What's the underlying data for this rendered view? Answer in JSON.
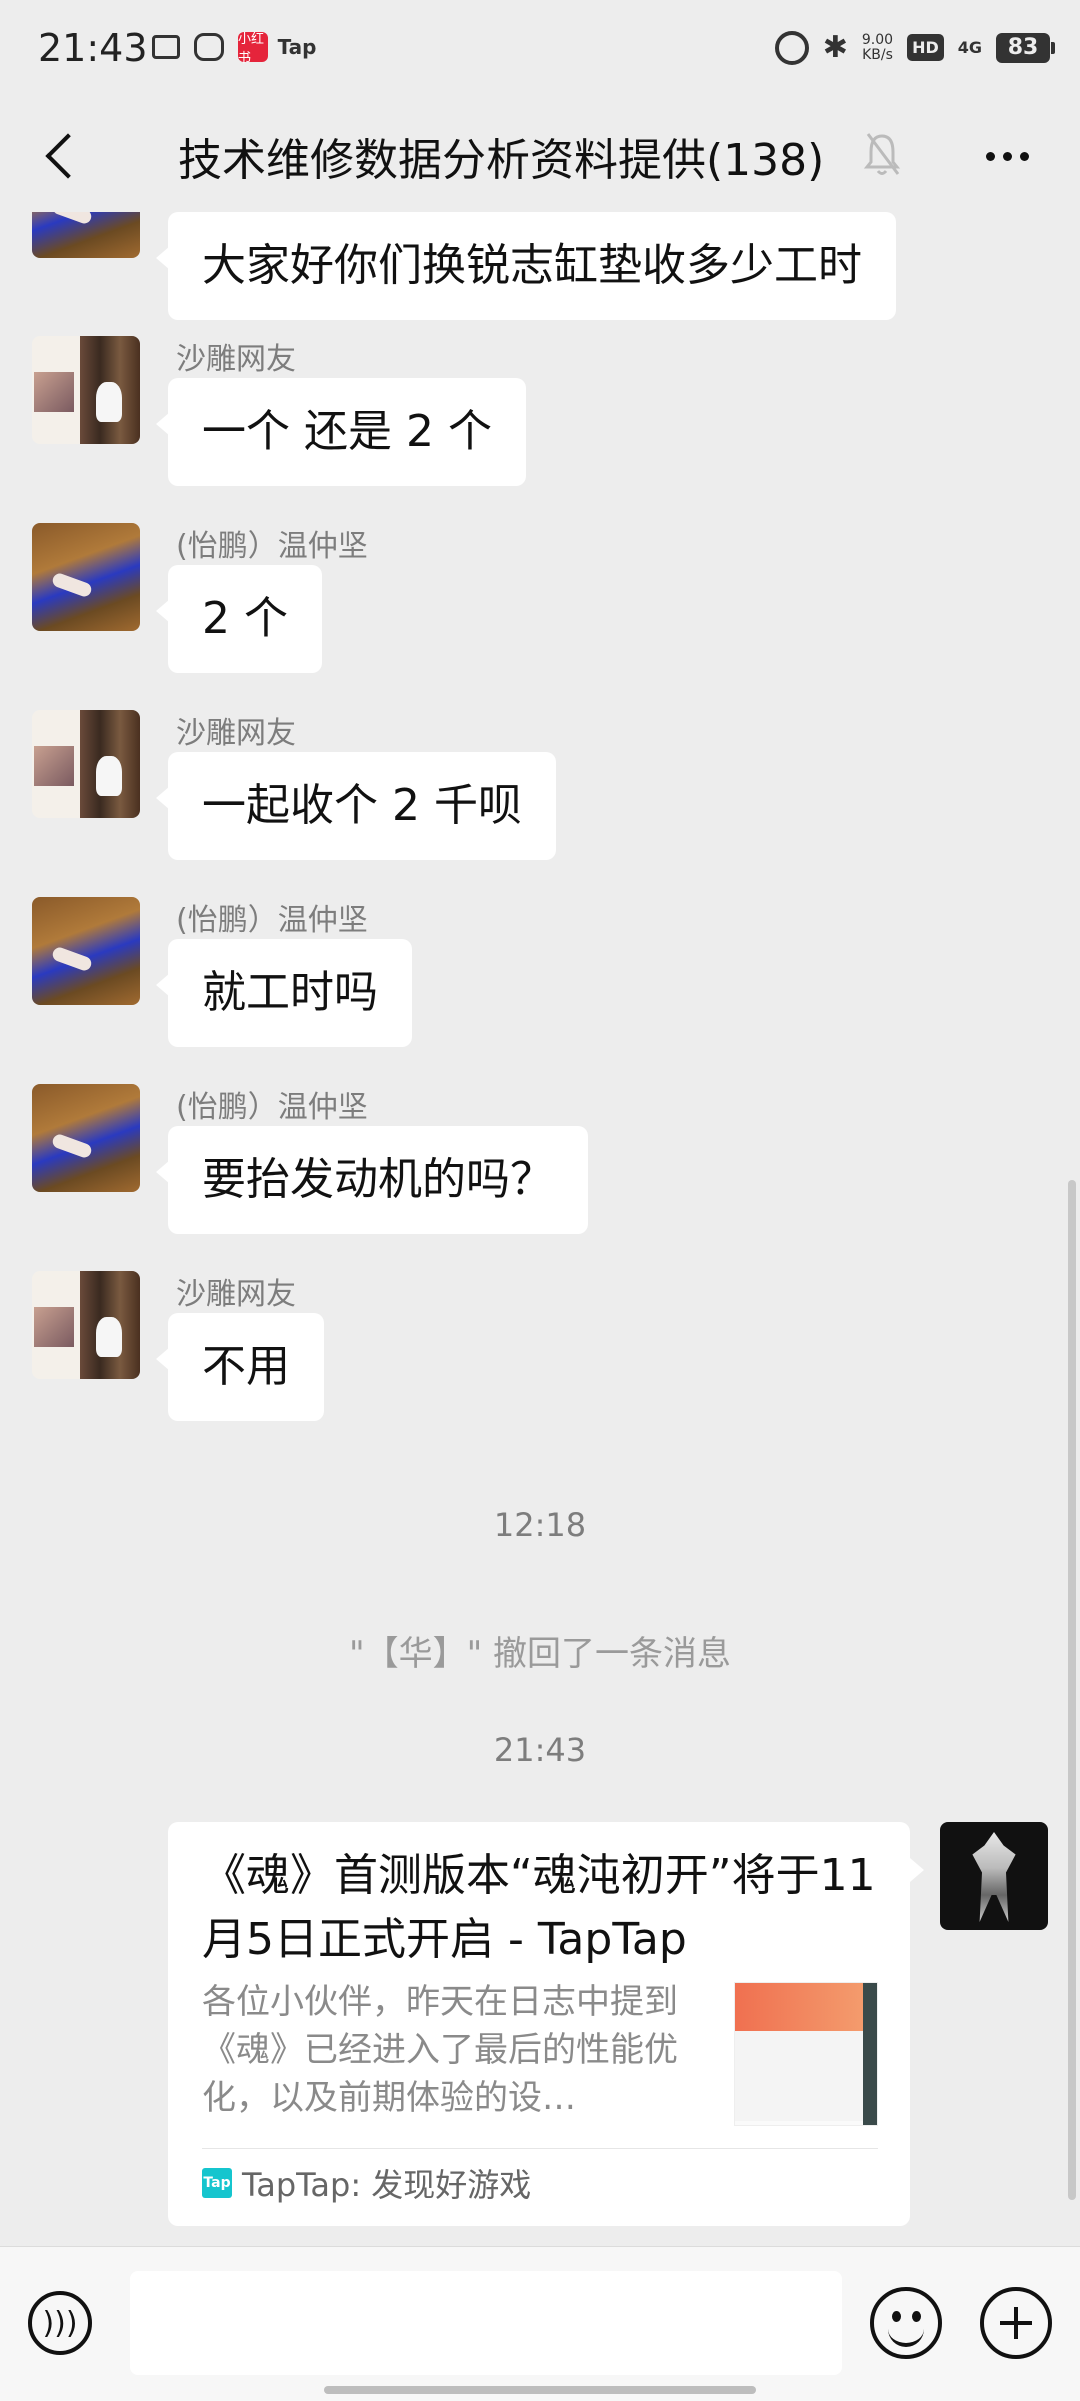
{
  "status_bar": {
    "time": "21:43",
    "app_badge_text": "Tap",
    "red_app_text": "小红书",
    "net_speed_value": "9.00",
    "net_speed_unit": "KB/s",
    "hd_label": "HD",
    "signal_label": "4G",
    "battery": "83"
  },
  "header": {
    "title": "技术维修数据分析资料提供(138)"
  },
  "messages": [
    {
      "sender": "",
      "text": "大家好你们换锐志缸垫收多少工时"
    },
    {
      "sender": "沙雕网友",
      "text": "一个  还是 2 个"
    },
    {
      "sender": "(怡鹏）温仲坚",
      "text": "2 个"
    },
    {
      "sender": "沙雕网友",
      "text": "一起收个 2 千呗"
    },
    {
      "sender": "(怡鹏）温仲坚",
      "text": "就工时吗"
    },
    {
      "sender": "(怡鹏）温仲坚",
      "text": "要抬发动机的吗？"
    },
    {
      "sender": "沙雕网友",
      "text": "不用"
    }
  ],
  "timestamps": [
    "12:18",
    "21:43"
  ],
  "system_message": "\"【华】\" 撤回了一条消息",
  "link_card": {
    "title": "《魂》首测版本“魂沌初开”将于11月5日正式开启  -  TapTap",
    "description": "各位小伙伴，昨天在日志中提到《魂》已经进入了最后的性能优化，以及前期体验的设…",
    "source_logo": "Tap",
    "source": "TapTap: 发现好游戏"
  },
  "input": {
    "placeholder": ""
  }
}
